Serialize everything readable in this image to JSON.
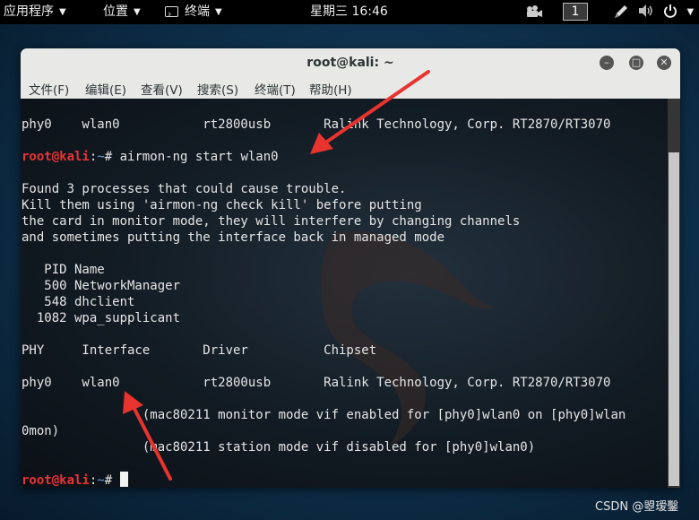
{
  "topbar": {
    "apps": "应用程序",
    "places": "位置",
    "terminal": "终端",
    "clock": "星期三 16:46",
    "workspace": "1"
  },
  "window": {
    "title": "root@kali: ~",
    "menu": [
      "文件(F)",
      "编辑(E)",
      "查看(V)",
      "搜索(S)",
      "终端(T)",
      "帮助(H)"
    ]
  },
  "terminal": {
    "prompt_user": "root@kali",
    "prompt_sep": ":",
    "prompt_path": "~",
    "prompt_hash": "# ",
    "lines": [
      "phy0    wlan0           rt2800usb       Ralink Technology, Corp. RT2870/RT3070",
      "",
      "",
      "Found 3 processes that could cause trouble.",
      "Kill them using 'airmon-ng check kill' before putting",
      "the card in monitor mode, they will interfere by changing channels",
      "and sometimes putting the interface back in managed mode",
      "",
      "   PID Name",
      "   500 NetworkManager",
      "   548 dhclient",
      "  1082 wpa_supplicant",
      "",
      "PHY     Interface       Driver          Chipset",
      "",
      "phy0    wlan0           rt2800usb       Ralink Technology, Corp. RT2870/RT3070",
      "                (mac80211 monitor mode vif enabled for [phy0]wlan0 on [phy0]wlan",
      "0mon)",
      "                (mac80211 station mode vif disabled for [phy0]wlan0)",
      "",
      ""
    ],
    "command": "airmon-ng start wlan0"
  },
  "watermark": "CSDN @曌瑷鑿"
}
